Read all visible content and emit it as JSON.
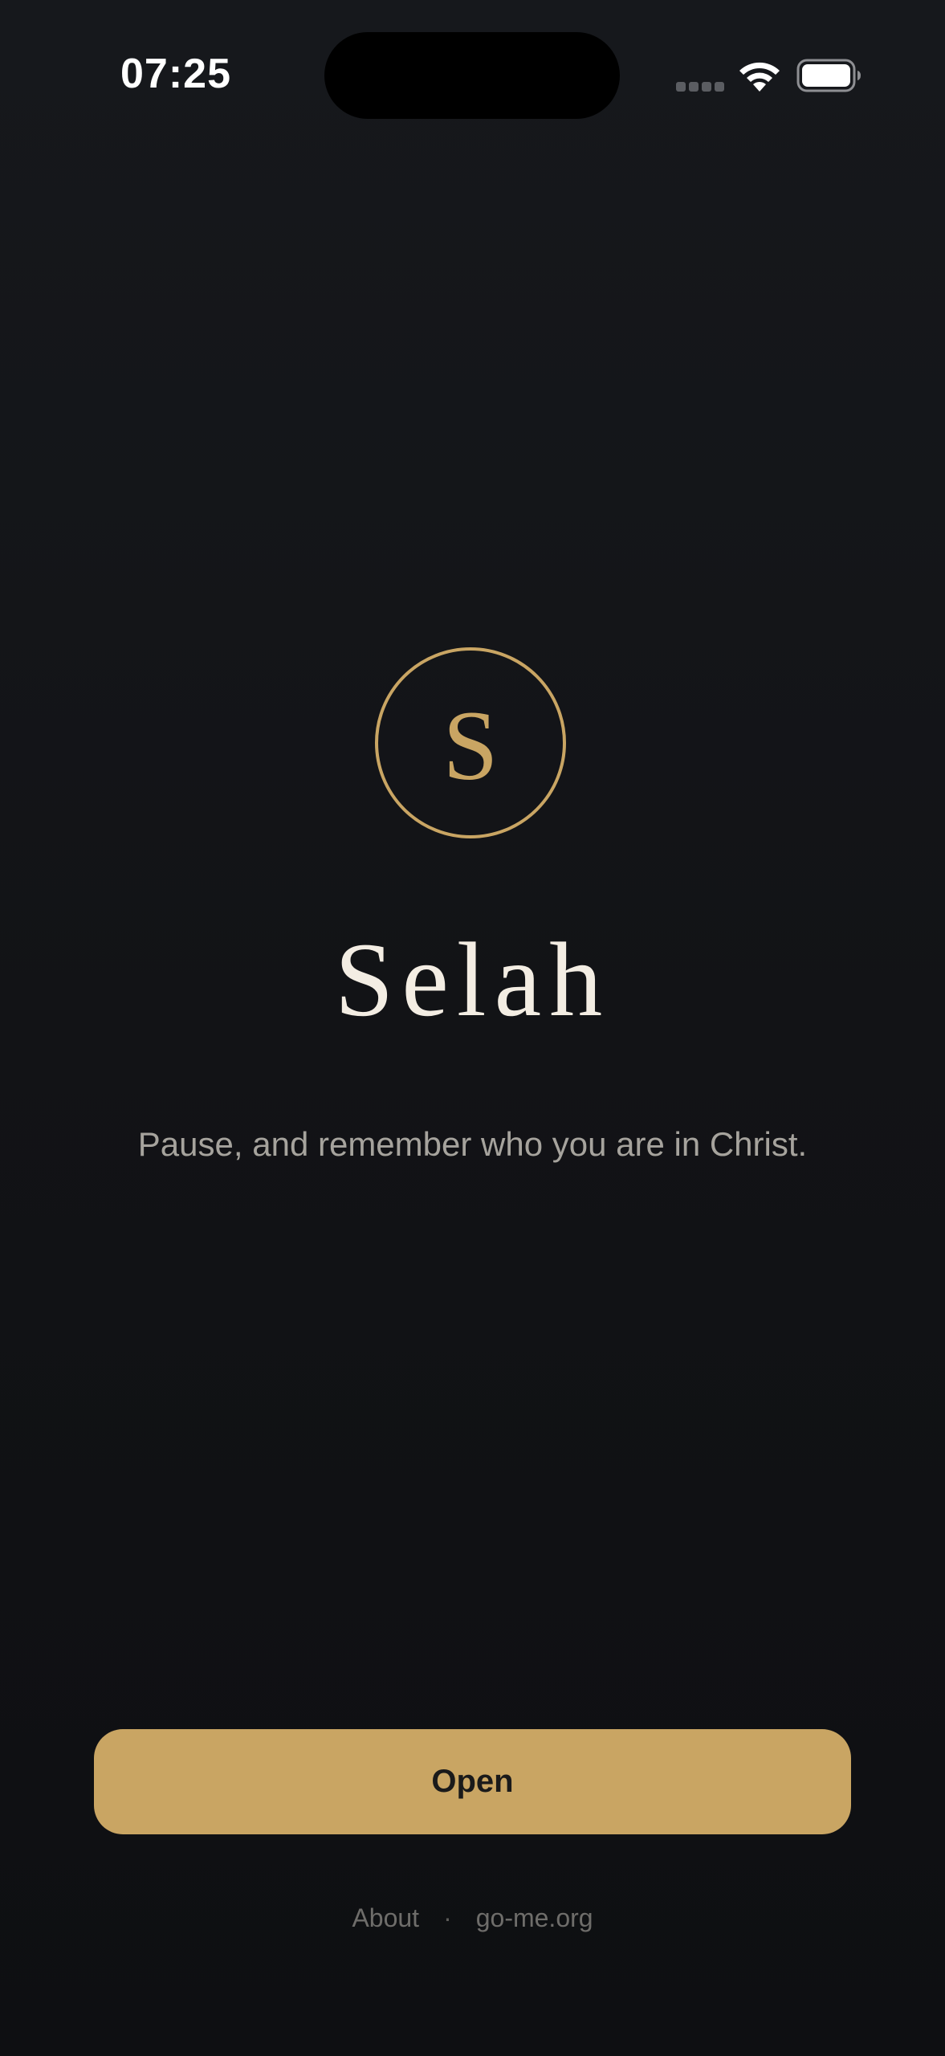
{
  "status_bar": {
    "time": "07:25"
  },
  "icons": {
    "signal": "cellular-signal-icon",
    "wifi": "wifi-icon",
    "battery": "battery-icon"
  },
  "logo": {
    "letter": "S"
  },
  "app": {
    "title": "Selah",
    "tagline": "Pause, and remember who you are in Christ."
  },
  "actions": {
    "open_label": "Open"
  },
  "footer": {
    "about_label": "About",
    "separator": "·",
    "site_label": "go-me.org"
  },
  "colors": {
    "accent": "#c9a563",
    "background": "#131417",
    "title_text": "#f3ede3",
    "tagline_text": "#a6a39d",
    "footer_text": "#6e6d6a"
  }
}
